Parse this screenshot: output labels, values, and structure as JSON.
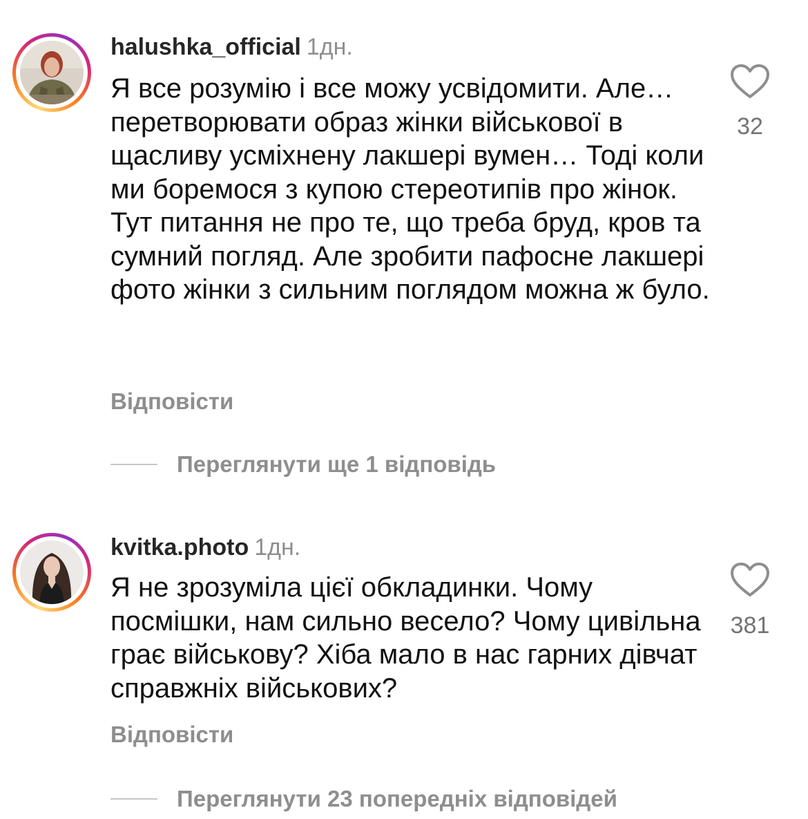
{
  "comments": [
    {
      "username": "halushka_official",
      "time": "1дн.",
      "text": "Я все розумію і все можу усвідомити. Але… перетворювати образ жінки військової в щасливу усміхнену лакшері вумен… Тоді коли ми боремося з купою стереотипів про жінок. Тут питання не про те, що треба бруд, кров та сумний погляд. Але зробити пафосне лакшері фото жінки з сильним поглядом можна ж було.",
      "likes": "32",
      "reply_label": "Відповісти",
      "view_replies_label": "Переглянути ще 1 відповідь"
    },
    {
      "username": "kvitka.photo",
      "time": "1дн.",
      "text": "Я не зрозуміла цієї обкладинки. Чому посмішки, нам сильно весело? Чому цивільна грає військову? Хіба мало в нас гарних дівчат справжніх військових?",
      "likes": "381",
      "reply_label": "Відповісти",
      "view_replies_label": "Переглянути 23 попередніх відповідей"
    }
  ],
  "icons": {
    "like": "heart-outline-icon"
  },
  "colors": {
    "secondary_text": "#8e8e8e",
    "divider": "#c7c7c7",
    "story_ring": "#d62976"
  }
}
